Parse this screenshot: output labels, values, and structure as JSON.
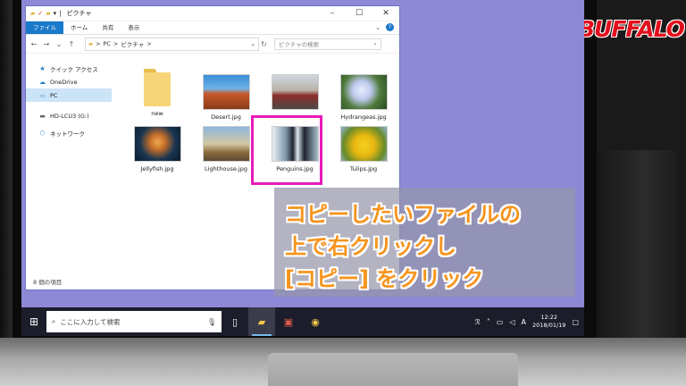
{
  "brand": "BUFFALO",
  "window": {
    "title": "ピクチャ",
    "ribbon_tabs": [
      "ファイル",
      "ホーム",
      "共有",
      "表示"
    ],
    "address": {
      "pc": "PC",
      "sep": ">",
      "folder": "ピクチャ"
    },
    "search_placeholder": "ピクチャの検索",
    "nav": [
      {
        "label": "クイック アクセス",
        "icon": "star-icon"
      },
      {
        "label": "OneDrive",
        "icon": "cloud-icon"
      },
      {
        "label": "PC",
        "icon": "computer-icon"
      },
      {
        "label": "HD-LCU3 (G:)",
        "icon": "drive-icon"
      },
      {
        "label": "ネットワーク",
        "icon": "network-icon"
      }
    ],
    "items": [
      {
        "label": "new",
        "kind": "folder"
      },
      {
        "label": "Desert.jpg",
        "kind": "image"
      },
      {
        "label": "Hydrangeas.jpg",
        "kind": "image"
      },
      {
        "label": "Jellyfish.jpg",
        "kind": "image"
      },
      {
        "label": "Lighthouse.jpg",
        "kind": "image"
      },
      {
        "label": "Penguins.jpg",
        "kind": "image"
      },
      {
        "label": "Tulips.jpg",
        "kind": "image"
      }
    ],
    "status": "8 個の項目"
  },
  "callout": {
    "line1": "コピーしたいファイルの",
    "line2": "上で右クリックし",
    "line3": "[コピー] をクリック"
  },
  "taskbar": {
    "search_placeholder": "ここに入力して検索",
    "time": "12:22",
    "date": "2018/01/19",
    "ime": "A"
  },
  "colors": {
    "desktop": "#8e88d7",
    "accent": "#1979ca",
    "highlight": "#e81abb",
    "callout_text": "#f7941d",
    "brand": "#e30f1c"
  }
}
